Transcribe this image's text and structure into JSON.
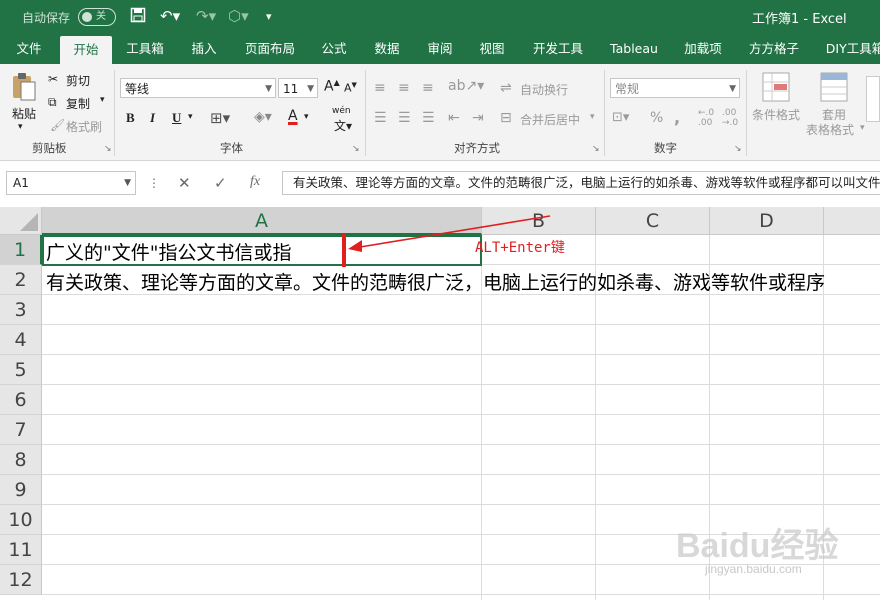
{
  "titlebar": {
    "autosave_label": "自动保存",
    "autosave_state": "关",
    "doc_title": "工作簿1  -  Excel"
  },
  "tabs": [
    "文件",
    "开始",
    "工具箱",
    "插入",
    "页面布局",
    "公式",
    "数据",
    "审阅",
    "视图",
    "开发工具",
    "Tableau",
    "加载项",
    "方方格子",
    "DIY工具箱"
  ],
  "active_tab": "开始",
  "ribbon": {
    "clipboard": {
      "paste": "粘贴",
      "cut": "剪切",
      "copy": "复制",
      "format_painter": "格式刷",
      "group": "剪贴板"
    },
    "font": {
      "name": "等线",
      "size": "11",
      "bold": "B",
      "italic": "I",
      "underline": "U",
      "wen": "wén",
      "group": "字体"
    },
    "alignment": {
      "wrap": "自动换行",
      "merge": "合并后居中",
      "group": "对齐方式"
    },
    "number": {
      "format": "常规",
      "percent": "%",
      "comma": ",",
      "group": "数字"
    },
    "styles": {
      "conditional": "条件格式",
      "table": "套用",
      "table2": "表格格式"
    }
  },
  "formula_bar": {
    "name_box": "A1",
    "cancel": "✕",
    "enter": "✓",
    "fx": "fx",
    "content": "有关政策、理论等方面的文章。文件的范畴很广泛，电脑上运行的如杀毒、游戏等软件或程序都可以叫文件。"
  },
  "grid": {
    "columns": [
      "A",
      "B",
      "C",
      "D"
    ],
    "rows": [
      "1",
      "2",
      "3",
      "4",
      "5",
      "6",
      "7",
      "8",
      "9",
      "10",
      "11",
      "12"
    ],
    "cells": {
      "A1": "广义的\"文件\"指公文书信或指",
      "A2": "有关政策、理论等方面的文章。文件的范畴很广泛，电脑上运行的如杀毒、游戏等软件或程序"
    }
  },
  "annotation": "ALT+Enter键",
  "watermark": {
    "brand": "Baidu经验",
    "url": "jingyan.baidu.com"
  },
  "colors": {
    "excel_green": "#217346",
    "annotation_red": "#e02020"
  }
}
